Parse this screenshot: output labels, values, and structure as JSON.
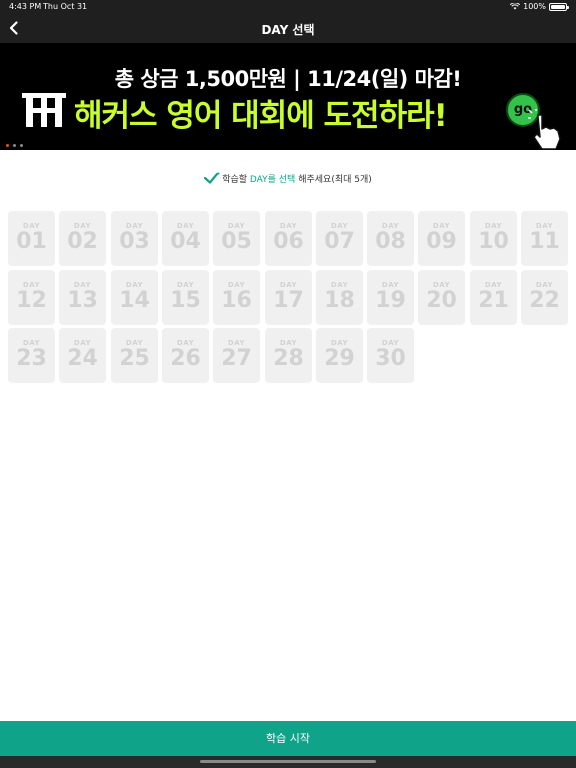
{
  "status_bar": {
    "time": "4:43 PM",
    "date": "Thu Oct 31",
    "battery": "100%"
  },
  "nav": {
    "title": "DAY 선택",
    "back_icon": "chevron-left-icon"
  },
  "banner": {
    "line1": "총 상금 1,500만원 | 11/24(일) 마감!",
    "line2": "해커스 영어 대회에 도전하라!",
    "go": "go",
    "line2_color": "#c8ff2a",
    "slides": 3,
    "active_slide": 0
  },
  "instruction": {
    "prefix": "학습할 ",
    "highlight": "DAY를 선택",
    "suffix": " 해주세요(최대 5개)"
  },
  "day_label": "DAY",
  "days": [
    "01",
    "02",
    "03",
    "04",
    "05",
    "06",
    "07",
    "08",
    "09",
    "10",
    "11",
    "12",
    "13",
    "14",
    "15",
    "16",
    "17",
    "18",
    "19",
    "20",
    "21",
    "22",
    "23",
    "24",
    "25",
    "26",
    "27",
    "28",
    "29",
    "30"
  ],
  "start_button": "학습 시작",
  "colors": {
    "accent": "#0fa38a",
    "bar": "#1f1f1f",
    "day_bg": "#f0f0f0",
    "day_text": "#d2d2d2"
  }
}
